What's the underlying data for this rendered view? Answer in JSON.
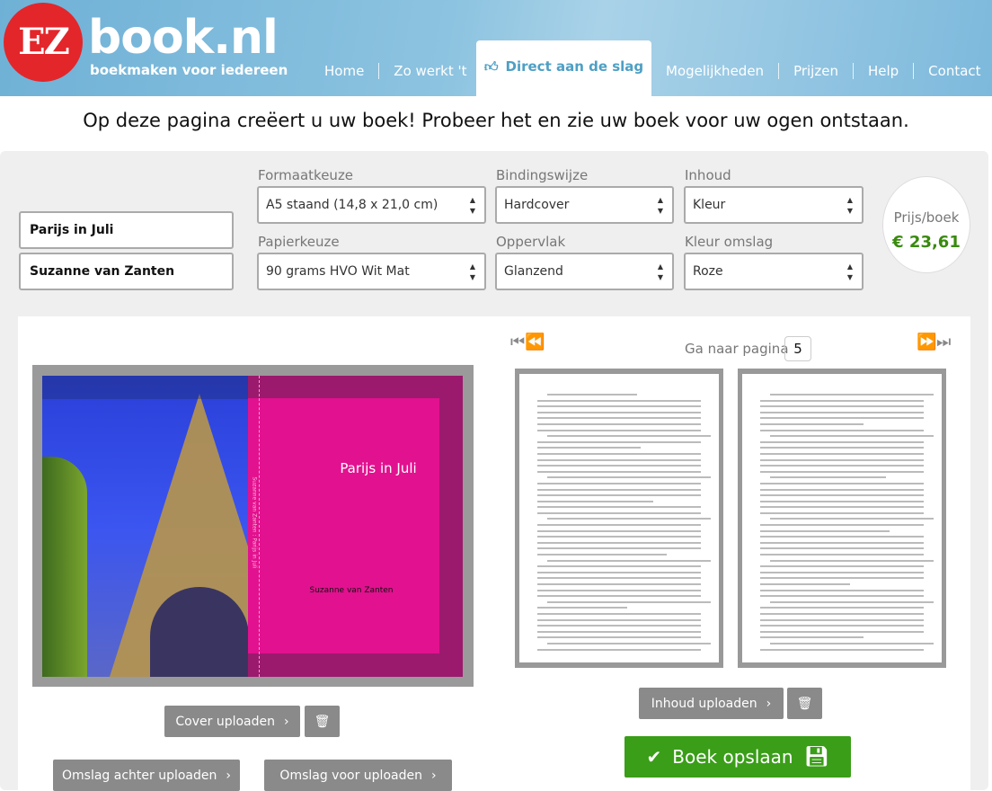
{
  "header": {
    "logo_mark": "EZ",
    "logo_word": "book.nl",
    "logo_sub": "boekmaken voor iedereen",
    "nav": [
      {
        "label": "Home"
      },
      {
        "label": "Zo werkt 't"
      },
      {
        "label": "Direct aan de slag",
        "active": true,
        "icon": "thumbs-up-icon"
      },
      {
        "label": "Mogelijkheden"
      },
      {
        "label": "Prijzen"
      },
      {
        "label": "Help"
      },
      {
        "label": "Contact"
      }
    ]
  },
  "tagline": "Op deze pagina creëert u uw boek! Probeer het en zie uw boek voor uw ogen ontstaan.",
  "form": {
    "title_value": "Parijs in Juli",
    "author_value": "Suzanne van Zanten",
    "format": {
      "label": "Formaatkeuze",
      "value": "A5 staand (14,8 x 21,0 cm)"
    },
    "binding": {
      "label": "Bindingswijze",
      "value": "Hardcover"
    },
    "content": {
      "label": "Inhoud",
      "value": "Kleur"
    },
    "paper": {
      "label": "Papierkeuze",
      "value": "90 grams HVO Wit Mat"
    },
    "surface": {
      "label": "Oppervlak",
      "value": "Glanzend"
    },
    "cover_color": {
      "label": "Kleur omslag",
      "value": "Roze"
    }
  },
  "price": {
    "label": "Prijs/boek",
    "value": "€ 23,61",
    "color": "#3a8a0f"
  },
  "cover": {
    "title": "Parijs in Juli",
    "author": "Suzanne van Zanten",
    "spine": "Suzanne van Zanten : Parijs in Juli",
    "color": "#e2118f"
  },
  "pager": {
    "goto_label": "Ga naar pagina",
    "page": "5"
  },
  "buttons": {
    "cover_upload": "Cover uploaden",
    "back_upload": "Omslag achter uploaden",
    "front_upload": "Omslag voor uploaden",
    "content_upload": "Inhoud uploaden",
    "save": "Boek opslaan",
    "save_color": "#3a9e18"
  }
}
